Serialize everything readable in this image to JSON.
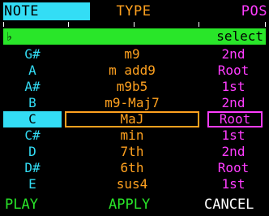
{
  "header": {
    "note": "NOTE",
    "type": "TYPE",
    "pos": "POS"
  },
  "bar": {
    "icon": "flat-icon",
    "icon_glyph": "♭",
    "select_label": "select"
  },
  "rows": [
    {
      "note": "G#",
      "type": "m9",
      "pos": "2nd"
    },
    {
      "note": "A",
      "type": "m add9",
      "pos": "Root"
    },
    {
      "note": "A#",
      "type": "m9b5",
      "pos": "1st"
    },
    {
      "note": "B",
      "type": "m9-Maj7",
      "pos": "2nd"
    },
    {
      "note": "C",
      "type": "MaJ",
      "pos": "Root"
    },
    {
      "note": "C#",
      "type": "min",
      "pos": "1st"
    },
    {
      "note": "D",
      "type": "7th",
      "pos": "2nd"
    },
    {
      "note": "D#",
      "type": "6th",
      "pos": "Root"
    },
    {
      "note": "E",
      "type": "sus4",
      "pos": "1st"
    }
  ],
  "footer": {
    "play": "PLAY",
    "apply": "APPLY",
    "cancel": "CANCEL"
  },
  "colors": {
    "note": "#33ddf5",
    "type": "#ffa11f",
    "pos": "#ff3dff",
    "bar": "#29e629",
    "background": "#000000"
  }
}
